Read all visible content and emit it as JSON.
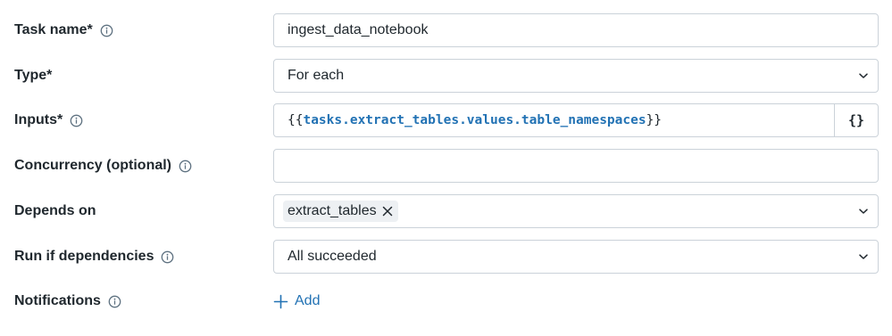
{
  "fields": {
    "task_name": {
      "label": "Task name*",
      "value": "ingest_data_notebook"
    },
    "type": {
      "label": "Type*",
      "value": "For each"
    },
    "inputs": {
      "label": "Inputs*",
      "open_brace": "{{",
      "reference": "tasks.extract_tables.values.table_namespaces",
      "close_brace": "}}",
      "expression_button": "{}"
    },
    "concurrency": {
      "label": "Concurrency (optional)",
      "value": ""
    },
    "depends_on": {
      "label": "Depends on",
      "tags": [
        "extract_tables"
      ]
    },
    "run_if": {
      "label": "Run if dependencies",
      "value": "All succeeded"
    },
    "notifications": {
      "label": "Notifications",
      "add_label": "Add"
    }
  },
  "colors": {
    "text": "#1f272d",
    "link": "#2272b4",
    "border": "#cbd2d9",
    "tag_background": "#edf0f3",
    "icon": "#5f7281"
  },
  "icons": {
    "info": "info-circle-icon",
    "chevron": "chevron-down-icon",
    "tag_remove": "close-icon",
    "add": "plus-icon"
  }
}
